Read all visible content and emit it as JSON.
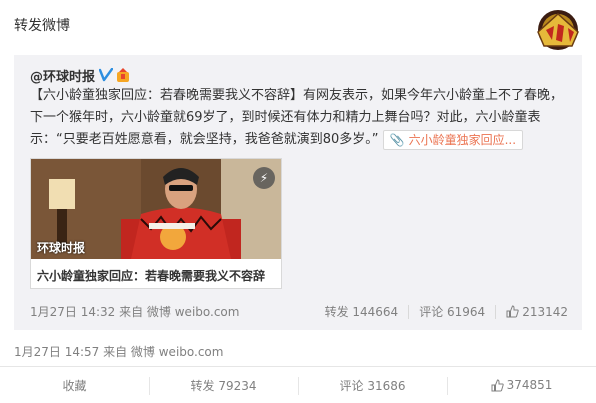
{
  "header": {
    "title": "转发微博"
  },
  "repost": {
    "author": "@环球时报",
    "text_before": "【六小龄童独家回应：若春晚需要我义不容辞】有网友表示，如果今年六小龄童上不了春晚，下一个猴年时，六小龄童就69岁了，到时候还有体力和精力上舞台吗？对此，六小龄童表示：“只要老百姓愿意看，就会坚持，我爸爸就演到80多岁。”",
    "link_chip": "六小龄童独家回应...",
    "card": {
      "title": "六小龄童独家回应：若春晚需要我义不容辞",
      "watermark": "环球时报"
    },
    "meta": "1月27日 14:32 来自 微博 weibo.com",
    "stats": {
      "repost": "转发 144664",
      "comment": "评论 61964",
      "like": "213142"
    }
  },
  "main": {
    "meta": "1月27日 14:57 来自 微博 weibo.com"
  },
  "footer": {
    "favorite": "收藏",
    "repost": "转发 79234",
    "comment": "评论 31686",
    "like": "374851"
  },
  "colors": {
    "link": "#eb7350",
    "verified": "#2d8ee0",
    "panel": "#f2f2f5"
  },
  "icons": [
    "verified-icon",
    "award-icon",
    "attachment-icon",
    "lightning-icon",
    "like-icon",
    "badge-logo"
  ]
}
